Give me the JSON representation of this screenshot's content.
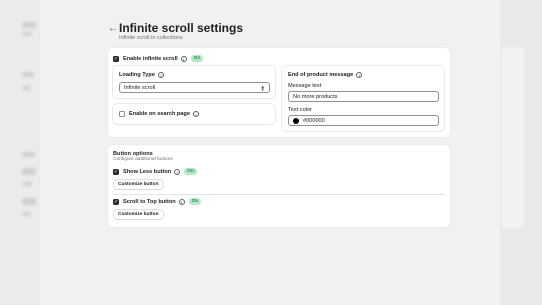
{
  "header": {
    "title": "Infinite scroll settings",
    "subtitle": "Infinite scroll in collections",
    "back_icon": "arrow-left-icon"
  },
  "general": {
    "enable_label": "Enable infinite scroll",
    "enable_checked": true,
    "enable_badge": "On",
    "loading_type_label": "Loading Type",
    "loading_type_value": "Infinite scroll",
    "search_label": "Enable on search page",
    "search_checked": false,
    "end_section_label": "End of product message",
    "message_text_label": "Message text",
    "message_text_value": "No more products",
    "text_color_label": "Text color",
    "text_color_value": "#000000"
  },
  "buttons": {
    "title": "Button options",
    "subtitle": "Configure additional buttons",
    "show_less_label": "Show Less button",
    "show_less_checked": true,
    "show_less_badge": "On",
    "show_less_customize": "Customize button",
    "scroll_top_label": "Scroll to Top button",
    "scroll_top_checked": true,
    "scroll_top_badge": "On",
    "scroll_top_customize": "Customize button"
  },
  "colors": {
    "badge_bg": "#aee9c8",
    "checkbox_checked": "#2c2c2c"
  }
}
